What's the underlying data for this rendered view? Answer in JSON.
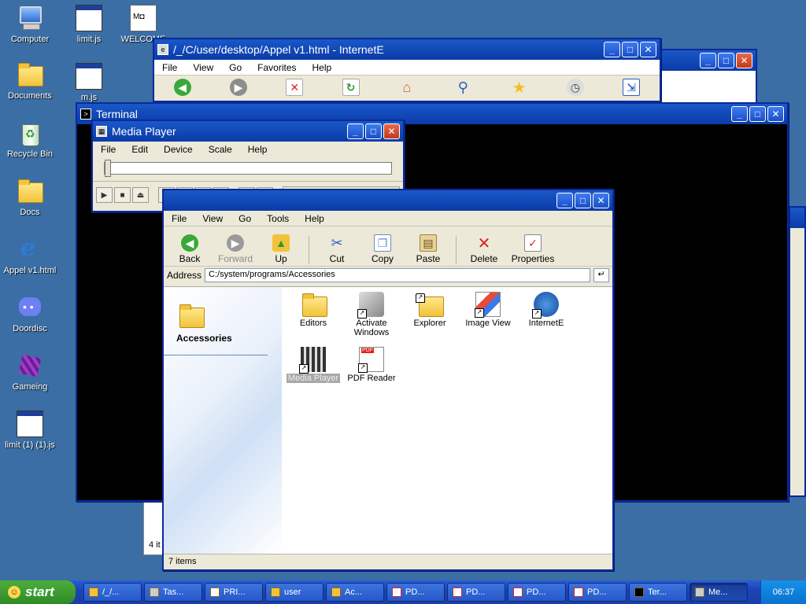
{
  "desktop": {
    "icons_col1": [
      {
        "label": "Computer",
        "icon": "computer-icon"
      },
      {
        "label": "Documents",
        "icon": "documents-folder-icon"
      },
      {
        "label": "Recycle Bin",
        "icon": "recycle-bin-icon"
      },
      {
        "label": "Docs",
        "icon": "folder-icon"
      },
      {
        "label": "Appel v1.html",
        "icon": "internet-explorer-icon"
      },
      {
        "label": "Doordisc",
        "icon": "discord-icon"
      },
      {
        "label": "Gameing",
        "icon": "cube-icon"
      },
      {
        "label": "limit (1) (1).js",
        "icon": "script-icon"
      }
    ],
    "icons_col2": [
      {
        "label": "limit.js",
        "icon": "script-icon"
      },
      {
        "label": "WELCOME",
        "icon": "document-icon"
      },
      {
        "label": "m.js",
        "icon": "script-icon"
      }
    ]
  },
  "browser": {
    "title": "/_/C/user/desktop/Appel v1.html - InternetE",
    "menu": [
      "File",
      "View",
      "Go",
      "Favorites",
      "Help"
    ]
  },
  "terminal": {
    "title": "Terminal"
  },
  "media_player": {
    "title": "Media Player",
    "menu": [
      "File",
      "Edit",
      "Device",
      "Scale",
      "Help"
    ],
    "position": 0
  },
  "explorer": {
    "menu": [
      "File",
      "View",
      "Go",
      "Tools",
      "Help"
    ],
    "toolbar": {
      "back": "Back",
      "forward": "Forward",
      "up": "Up",
      "cut": "Cut",
      "copy": "Copy",
      "paste": "Paste",
      "delete": "Delete",
      "properties": "Properties"
    },
    "address_label": "Address",
    "address_value": "C:/system/programs/Accessories",
    "folder_name": "Accessories",
    "items": [
      {
        "label": "Editors",
        "icon": "folder-icon"
      },
      {
        "label": "Activate Windows",
        "icon": "activate-windows-icon"
      },
      {
        "label": "Explorer",
        "icon": "explorer-icon"
      },
      {
        "label": "Image View",
        "icon": "image-view-icon"
      },
      {
        "label": "InternetE",
        "icon": "internet-explorer-icon"
      },
      {
        "label": "Media Player",
        "icon": "media-player-icon"
      },
      {
        "label": "PDF Reader",
        "icon": "pdf-reader-icon"
      }
    ],
    "status": "7 items"
  },
  "background_window_status": "4 it",
  "taskbar": {
    "start_label": "start",
    "tasks": [
      "/_/...",
      "Tas...",
      "PRI...",
      "user",
      "Ac...",
      "PD...",
      "PD...",
      "PD...",
      "PD...",
      "Ter...",
      "Me..."
    ],
    "clock": "06:37"
  }
}
